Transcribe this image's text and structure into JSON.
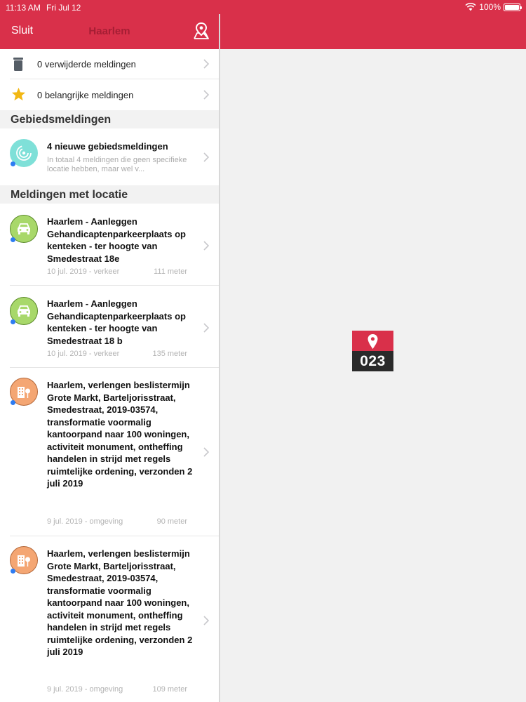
{
  "statusbar": {
    "time": "11:13 AM",
    "date": "Fri Jul 12",
    "battery": "100%"
  },
  "navbar": {
    "close_label": "Sluit",
    "title": "Haarlem"
  },
  "quick": [
    {
      "label": "0 verwijderde meldingen",
      "icon": "trash-icon"
    },
    {
      "label": "0 belangrijke meldingen",
      "icon": "star-icon"
    }
  ],
  "sections": {
    "area": "Gebiedsmeldingen",
    "location": "Meldingen met locatie"
  },
  "area_item": {
    "title": "4 nieuwe gebiedsmeldingen",
    "subtitle": "In totaal 4 meldingen die geen specifieke locatie hebben, maar wel v..."
  },
  "items": [
    {
      "title": "Haarlem - Aanleggen Gehandicaptenparkeerplaats op kenteken - ter hoogte van Smedestraat 18e",
      "meta": "10 jul. 2019 - verkeer",
      "distance": "111 meter",
      "icon": "car-icon"
    },
    {
      "title": "Haarlem - Aanleggen Gehandicaptenparkeerplaats op kenteken - ter hoogte van Smedestraat 18 b",
      "meta": "10 jul. 2019 - verkeer",
      "distance": "135 meter",
      "icon": "car-icon"
    },
    {
      "title": "Haarlem, verlengen beslistermijn Grote Markt, Barteljorisstraat, Smedestraat, 2019-03574, transformatie voormalig kantoorpand naar 100 woningen, activiteit monument, ontheffing handelen in strijd met regels ruimtelijke ordening, verzonden 2 juli 2019",
      "meta": "9 jul. 2019 - omgeving",
      "distance": "90 meter",
      "icon": "building-icon"
    },
    {
      "title": "Haarlem, verlengen beslistermijn Grote Markt, Barteljorisstraat, Smedestraat, 2019-03574, transformatie voormalig kantoorpand naar 100 woningen, activiteit monument, ontheffing handelen in strijd met regels ruimtelijke ordening, verzonden 2 juli 2019",
      "meta": "9 jul. 2019 - omgeving",
      "distance": "109 meter",
      "icon": "building-icon"
    }
  ],
  "logo": {
    "text": "023"
  },
  "colors": {
    "brand": "#d9304a",
    "unread_dot": "#2d7cf2",
    "traffic": "#a8d86a",
    "environment": "#f4a673",
    "area": "#7fe0d8"
  }
}
